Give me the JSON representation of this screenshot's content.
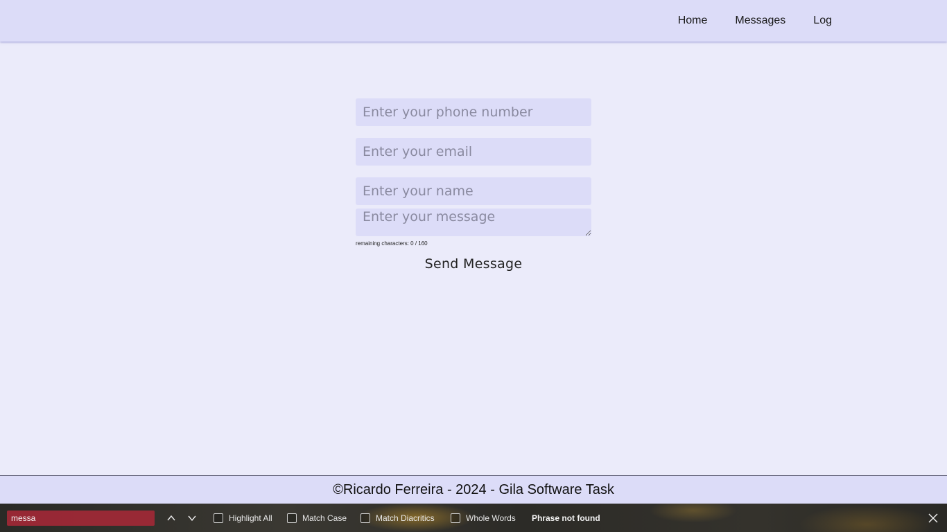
{
  "nav": {
    "items": [
      {
        "label": "Home"
      },
      {
        "label": "Messages"
      },
      {
        "label": "Log"
      }
    ]
  },
  "form": {
    "phone_placeholder": "Enter your phone number",
    "email_placeholder": "Enter your email",
    "name_placeholder": "Enter your name",
    "message_placeholder": "Enter your message",
    "counter_text": "remaining characters: 0 / 160",
    "send_label": "Send Message"
  },
  "footer": {
    "text": "©Ricardo Ferreira - 2024 - Gila Software Task"
  },
  "findbar": {
    "query": "messa",
    "options": [
      {
        "label": "Highlight All"
      },
      {
        "label": "Match Case"
      },
      {
        "label": "Match Diacritics"
      },
      {
        "label": "Whole Words"
      }
    ],
    "status": "Phrase not found",
    "input_color": "#aa2837"
  }
}
